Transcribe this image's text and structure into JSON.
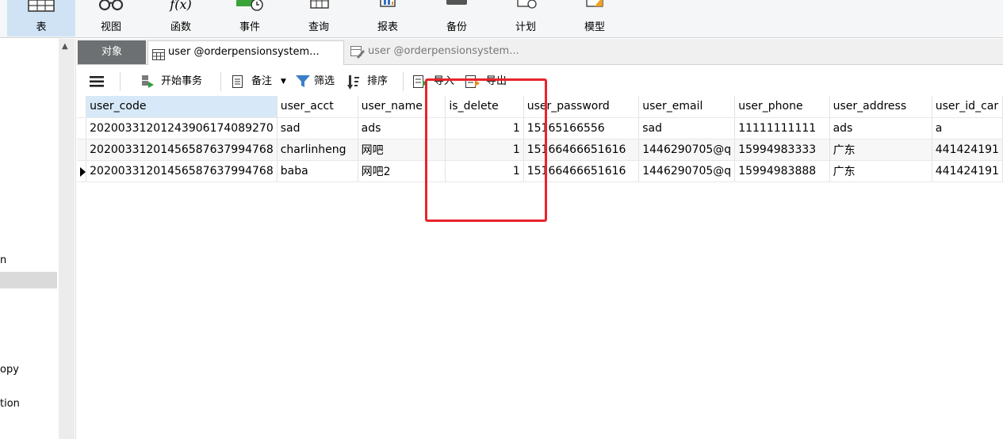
{
  "ribbon": {
    "buttons": [
      {
        "label": "表",
        "icon": "table-icon"
      },
      {
        "label": "视图",
        "icon": "view-glasses-icon"
      },
      {
        "label": "函数",
        "icon": "function-fx-icon"
      },
      {
        "label": "事件",
        "icon": "event-clock-icon"
      },
      {
        "label": "查询",
        "icon": "query-grid-icon"
      },
      {
        "label": "报表",
        "icon": "report-chart-icon"
      },
      {
        "label": "备份",
        "icon": "backup-icon"
      },
      {
        "label": "计划",
        "icon": "schedule-icon"
      },
      {
        "label": "模型",
        "icon": "model-icon"
      }
    ],
    "function_glyph": "f(x)"
  },
  "leftnav": {
    "items": [
      "n",
      "opy",
      "tion"
    ]
  },
  "tabs": {
    "objects": "对象",
    "active": "user @orderpensionsystem...",
    "design": "user @orderpensionsystem..."
  },
  "toolbar": {
    "begin_transaction": "开始事务",
    "memo": "备注",
    "filter": "筛选",
    "sort": "排序",
    "import": "导入",
    "export": "导出"
  },
  "grid": {
    "columns": [
      "user_code",
      "user_acct",
      "user_name",
      "is_delete",
      "user_password",
      "user_email",
      "user_phone",
      "user_address",
      "user_id_car"
    ],
    "rows": [
      [
        "20200331201243906174089270",
        "sad",
        "ads",
        "1",
        "15165166556",
        "sad",
        "11111111111",
        "ads",
        "a"
      ],
      [
        "20200331201456587637994768",
        "charlinheng",
        "网吧",
        "1",
        "15166466651616",
        "1446290705@q",
        "15994983333",
        "广东",
        "441424191"
      ],
      [
        "20200331201456587637994768",
        "baba",
        "网吧2",
        "1",
        "15166466651616",
        "1446290705@q",
        "15994983888",
        "广东",
        "441424191"
      ]
    ],
    "current_row": 2
  },
  "colors": {
    "annotation": "#e8242b",
    "selected_header": "#d7e9f8",
    "active_ribbon": "#cfe3f4"
  }
}
